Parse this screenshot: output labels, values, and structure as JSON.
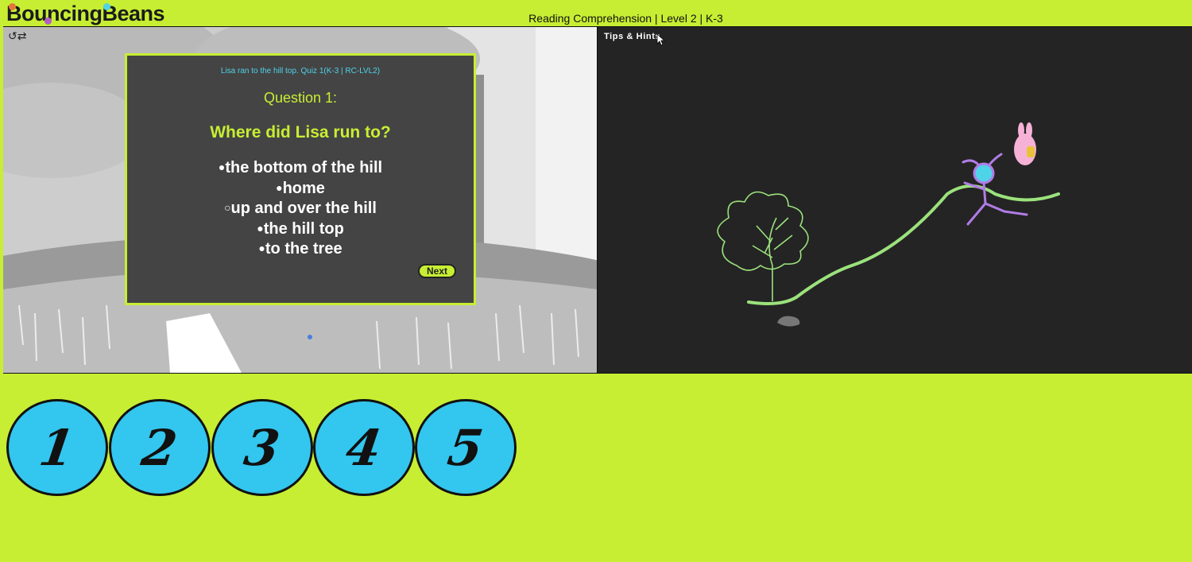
{
  "header": {
    "logo_text": "BouncingBeans",
    "lesson_title": "Reading Comprehension | Level 2 | K-3"
  },
  "quiz": {
    "reference": "Lisa ran to the hill top. Quiz 1(K-3 | RC-LVL2)",
    "question_number": "Question 1:",
    "question": "Where did Lisa run to?",
    "answers": [
      {
        "bullet": "●",
        "text": "the bottom of the hill"
      },
      {
        "bullet": "●",
        "text": "home"
      },
      {
        "bullet": "○",
        "text": "up and over the hill"
      },
      {
        "bullet": "●",
        "text": "the hill top"
      },
      {
        "bullet": "●",
        "text": "to the tree"
      }
    ],
    "next_label": "Next"
  },
  "right_panel": {
    "tips_label": "Tips & Hints"
  },
  "number_buttons": [
    "1",
    "2",
    "3",
    "4",
    "5"
  ],
  "colors": {
    "accent": "#c7ee33",
    "cyan": "#33c6ee",
    "card": "#444444",
    "dark_panel": "#242424",
    "line_green": "#9be27c",
    "character_purple": "#b07ce6",
    "bunny_pink": "#f6b2d6"
  },
  "icons": {
    "tool": "arrow-swap-icon",
    "cursor": "mouse-pointer-icon"
  }
}
